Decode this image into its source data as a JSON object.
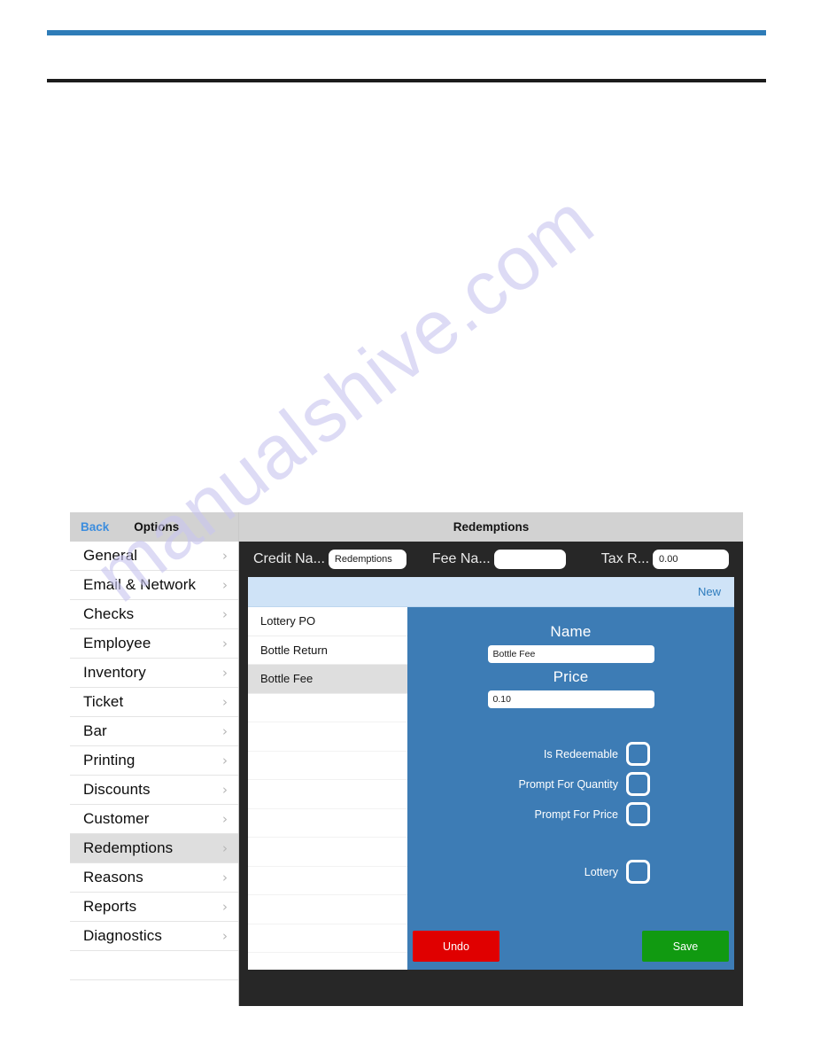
{
  "watermark": {
    "text": "manualshive.com"
  },
  "sidebar": {
    "back_label": "Back",
    "title": "Options",
    "chevron": "›",
    "items": [
      {
        "label": "General"
      },
      {
        "label": "Email & Network"
      },
      {
        "label": "Checks"
      },
      {
        "label": "Employee"
      },
      {
        "label": "Inventory"
      },
      {
        "label": "Ticket"
      },
      {
        "label": "Bar"
      },
      {
        "label": "Printing"
      },
      {
        "label": "Discounts"
      },
      {
        "label": "Customer"
      },
      {
        "label": "Redemptions"
      },
      {
        "label": "Reasons"
      },
      {
        "label": "Reports"
      },
      {
        "label": "Diagnostics"
      }
    ],
    "selected": "Redemptions"
  },
  "app": {
    "title": "Redemptions",
    "toolbar": {
      "credit_label": "Credit Na...",
      "credit_value": "Redemptions",
      "fee_label": "Fee Na...",
      "fee_value": "",
      "tax_label": "Tax R...",
      "tax_value": "0.00"
    },
    "new_label": "New",
    "list": [
      {
        "label": "Lottery PO",
        "selected": false
      },
      {
        "label": "Bottle Return",
        "selected": false
      },
      {
        "label": "Bottle Fee",
        "selected": true
      }
    ],
    "detail": {
      "name_label": "Name",
      "name_value": "Bottle Fee",
      "price_label": "Price",
      "price_value": "0.10",
      "checkboxes": [
        {
          "label": "Is Redeemable",
          "checked": false
        },
        {
          "label": "Prompt For Quantity",
          "checked": false
        },
        {
          "label": "Prompt For Price",
          "checked": false
        }
      ],
      "lottery": {
        "label": "Lottery",
        "checked": false
      },
      "undo_label": "Undo",
      "save_label": "Save"
    }
  },
  "colors": {
    "rule_blue": "#2e7cb8",
    "rule_black": "#1c1c1c",
    "panel_blue": "#3d7cb5",
    "undo_red": "#e00000",
    "save_green": "#119a11",
    "link_blue": "#3c8dde"
  }
}
